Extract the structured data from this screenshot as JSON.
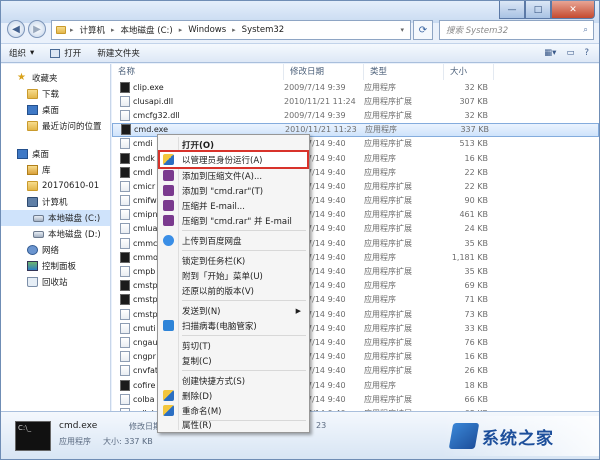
{
  "window": {
    "controls": [
      "—",
      "□",
      "✕"
    ]
  },
  "address": {
    "crumbs": [
      "计算机",
      "本地磁盘 (C:)",
      "Windows",
      "System32"
    ],
    "search_placeholder": "搜索 System32"
  },
  "toolbar": {
    "organize": "组织",
    "open": "打开",
    "new_folder": "新建文件夹"
  },
  "nav": {
    "favorites": "收藏夹",
    "downloads": "下载",
    "desktop": "桌面",
    "recent": "最近访问的位置",
    "desktop2": "桌面",
    "library": "库",
    "folder_date": "20170610-01",
    "computer": "计算机",
    "drive_c": "本地磁盘 (C:)",
    "drive_d": "本地磁盘 (D:)",
    "network": "网络",
    "control_panel": "控制面板",
    "recycle_bin": "回收站"
  },
  "columns": {
    "name": "名称",
    "date": "修改日期",
    "type": "类型",
    "size": "大小"
  },
  "files": [
    {
      "name": "clip.exe",
      "date": "2009/7/14 9:39",
      "type": "应用程序",
      "size": "32 KB"
    },
    {
      "name": "clusapi.dll",
      "date": "2010/11/21 11:24",
      "type": "应用程序扩展",
      "size": "307 KB"
    },
    {
      "name": "cmcfg32.dll",
      "date": "2009/7/14 9:39",
      "type": "应用程序扩展",
      "size": "32 KB"
    },
    {
      "name": "cmd.exe",
      "date": "2010/11/21 11:23",
      "type": "应用程序",
      "size": "337 KB"
    },
    {
      "name": "cmdi",
      "date": "2009/7/14 9:40",
      "type": "应用程序扩展",
      "size": "513 KB"
    },
    {
      "name": "cmdk",
      "date": "2009/7/14 9:40",
      "type": "应用程序",
      "size": "16 KB"
    },
    {
      "name": "cmdl",
      "date": "2009/7/14 9:40",
      "type": "应用程序",
      "size": "22 KB"
    },
    {
      "name": "cmicr",
      "date": "2009/7/14 9:40",
      "type": "应用程序扩展",
      "size": "22 KB"
    },
    {
      "name": "cmifw",
      "date": "2009/7/14 9:40",
      "type": "应用程序扩展",
      "size": "90 KB"
    },
    {
      "name": "cmipn",
      "date": "2009/7/14 9:40",
      "type": "应用程序扩展",
      "size": "461 KB"
    },
    {
      "name": "cmlua",
      "date": "2009/7/14 9:40",
      "type": "应用程序扩展",
      "size": "24 KB"
    },
    {
      "name": "cmmc",
      "date": "2009/7/14 9:40",
      "type": "应用程序扩展",
      "size": "35 KB"
    },
    {
      "name": "cmmo",
      "date": "2009/7/14 9:40",
      "type": "应用程序",
      "size": "1,181 KB"
    },
    {
      "name": "cmpb",
      "date": "2009/7/14 9:40",
      "type": "应用程序扩展",
      "size": "35 KB"
    },
    {
      "name": "cmstp",
      "date": "2009/7/14 9:40",
      "type": "应用程序",
      "size": "69 KB"
    },
    {
      "name": "cmstp",
      "date": "2009/7/14 9:40",
      "type": "应用程序",
      "size": "71 KB"
    },
    {
      "name": "cmstp",
      "date": "2009/7/14 9:40",
      "type": "应用程序扩展",
      "size": "73 KB"
    },
    {
      "name": "cmuti",
      "date": "2009/7/14 9:40",
      "type": "应用程序扩展",
      "size": "33 KB"
    },
    {
      "name": "cngau",
      "date": "2009/7/14 9:40",
      "type": "应用程序扩展",
      "size": "76 KB"
    },
    {
      "name": "cngpr",
      "date": "2009/7/14 9:40",
      "type": "应用程序扩展",
      "size": "16 KB"
    },
    {
      "name": "cnvfat",
      "date": "2009/7/14 9:40",
      "type": "应用程序扩展",
      "size": "26 KB"
    },
    {
      "name": "cofire",
      "date": "2009/7/14 9:40",
      "type": "应用程序",
      "size": "18 KB"
    },
    {
      "name": "colba",
      "date": "2009/7/14 9:40",
      "type": "应用程序扩展",
      "size": "66 KB"
    },
    {
      "name": "collab",
      "date": "2009/7/14 9:40",
      "type": "应用程序扩展",
      "size": "68 KB"
    }
  ],
  "context_menu": {
    "open": "打开(O)",
    "run_as_admin": "以管理员身份运行(A)",
    "add_archive": "添加到压缩文件(A)...",
    "add_cmd_rar": "添加到 \"cmd.rar\"(T)",
    "compress_email": "压缩并 E-mail...",
    "compress_cmd_email": "压缩到 \"cmd.rar\" 并 E-mail",
    "upload_baidu": "上传到百度网盘",
    "pin_taskbar": "锁定到任务栏(K)",
    "pin_start": "附到「开始」菜单(U)",
    "restore_versions": "还原以前的版本(V)",
    "send_to": "发送到(N)",
    "scan_virus": "扫描病毒(电脑管家)",
    "cut": "剪切(T)",
    "copy": "复制(C)",
    "create_shortcut": "创建快捷方式(S)",
    "delete": "删除(D)",
    "rename": "重命名(M)",
    "properties": "属性(R)"
  },
  "details": {
    "name": "cmd.exe",
    "type": "应用程序",
    "modified": "修改日期: 2010/",
    "size": "大小: 337 KB",
    "tail": "23"
  },
  "watermark": {
    "text": "系统之家"
  },
  "colors": {
    "highlight_border": "#d8332b",
    "selection": "#cfe3fb"
  }
}
